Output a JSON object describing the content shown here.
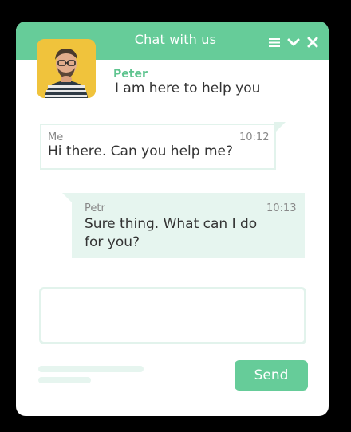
{
  "header": {
    "title": "Chat with us",
    "icons": [
      "menu-icon",
      "chevron-down-icon",
      "close-icon"
    ]
  },
  "agent": {
    "name": "Peter",
    "status": "I am here to help you"
  },
  "messages": [
    {
      "sender": "Me",
      "time": "10:12",
      "text": "Hi there. Can you help me?"
    },
    {
      "sender": "Petr",
      "time": "10:13",
      "text_line1": "Sure thing. What can I do",
      "text_line2": "for you?"
    }
  ],
  "composer": {
    "placeholder": "",
    "send_label": "Send"
  },
  "colors": {
    "accent": "#66cc99",
    "accent_light": "#e6f5ef",
    "agent_name": "#5fc48f",
    "avatar_bg": "#f0c33c"
  }
}
